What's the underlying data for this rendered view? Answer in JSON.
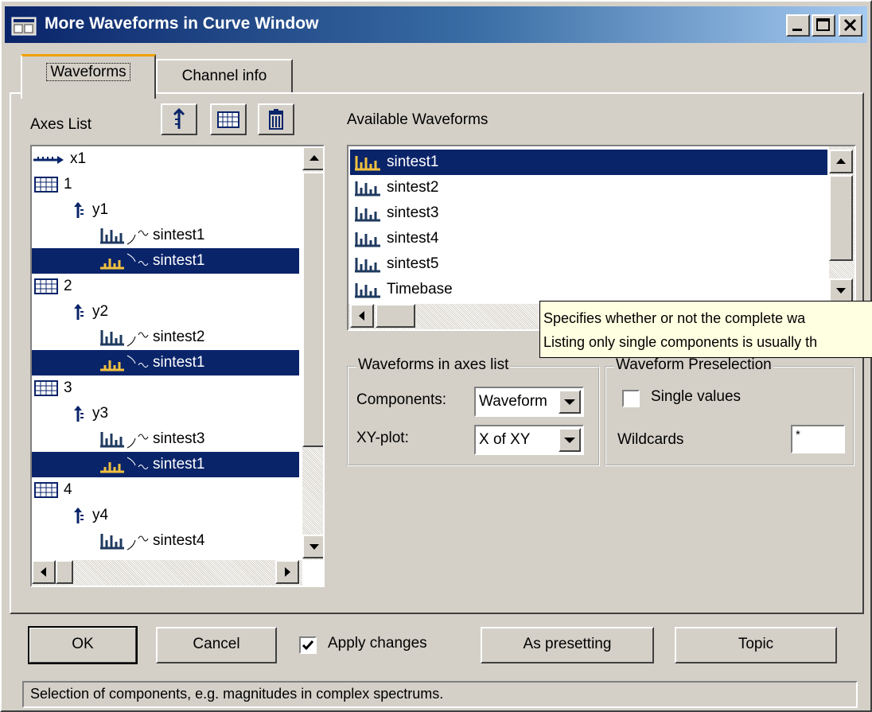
{
  "window": {
    "title": "More Waveforms in Curve Window"
  },
  "tabs": [
    {
      "label": "Waveforms",
      "active": true
    },
    {
      "label": "Channel info",
      "active": false
    }
  ],
  "axes_list": {
    "label": "Axes List",
    "toolbar_icons": [
      "add-y-axis-icon",
      "add-axes-system-icon",
      "trash-icon"
    ],
    "items": [
      {
        "text": "x1",
        "icon": "x-axis-icon",
        "selected": false
      },
      {
        "text": "1",
        "icon": "axes-system-icon",
        "selected": false
      },
      {
        "text": "y1",
        "icon": "y-axis-icon",
        "selected": false
      },
      {
        "text": "sintest1",
        "icon": "waveform-icon",
        "selected": false
      },
      {
        "text": "sintest1",
        "icon": "waveform-icon",
        "selected": true
      },
      {
        "text": "2",
        "icon": "axes-system-icon",
        "selected": false
      },
      {
        "text": "y2",
        "icon": "y-axis-icon",
        "selected": false
      },
      {
        "text": "sintest2",
        "icon": "waveform-icon",
        "selected": false
      },
      {
        "text": "sintest1",
        "icon": "waveform-icon",
        "selected": true
      },
      {
        "text": "3",
        "icon": "axes-system-icon",
        "selected": false
      },
      {
        "text": "y3",
        "icon": "y-axis-icon",
        "selected": false
      },
      {
        "text": "sintest3",
        "icon": "waveform-icon",
        "selected": false
      },
      {
        "text": "sintest1",
        "icon": "waveform-icon",
        "selected": true
      },
      {
        "text": "4",
        "icon": "axes-system-icon",
        "selected": false
      },
      {
        "text": "y4",
        "icon": "y-axis-icon",
        "selected": false
      },
      {
        "text": "sintest4",
        "icon": "waveform-icon",
        "selected": false
      }
    ]
  },
  "available_waveforms": {
    "label": "Available Waveforms",
    "items": [
      {
        "text": "sintest1",
        "selected": true
      },
      {
        "text": "sintest2",
        "selected": false
      },
      {
        "text": "sintest3",
        "selected": false
      },
      {
        "text": "sintest4",
        "selected": false
      },
      {
        "text": "sintest5",
        "selected": false
      },
      {
        "text": "Timebase",
        "selected": false
      }
    ]
  },
  "tooltip": {
    "line1": "Specifies whether or not the complete wa",
    "line2": "Listing only single components is usually th"
  },
  "waveforms_in_axes_list": {
    "title": "Waveforms in axes list",
    "components_label": "Components:",
    "components_value": "Waveform",
    "xy_label": "XY-plot:",
    "xy_value": "X of XY"
  },
  "waveform_preselection": {
    "title": "Waveform Preselection",
    "single_values_label": "Single values",
    "single_values_checked": false,
    "wildcards_label": "Wildcards",
    "wildcards_value": "*"
  },
  "buttons": {
    "ok": "OK",
    "cancel": "Cancel",
    "apply_label": "Apply changes",
    "apply_checked": true,
    "presetting": "As presetting",
    "topic": "Topic"
  },
  "status": "Selection of components, e.g. magnitudes in complex spectrums."
}
